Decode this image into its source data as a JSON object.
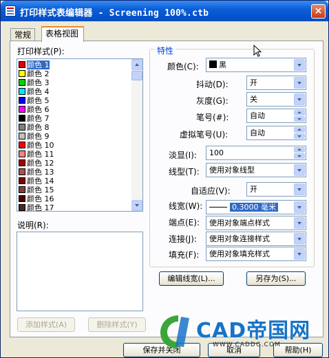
{
  "window": {
    "title": "打印样式表编辑器 - Screening 100%.ctb",
    "close": "×"
  },
  "tabs": [
    "常规",
    "表格视图"
  ],
  "left": {
    "styles_label": "打印样式(P):",
    "items": [
      {
        "label": "颜色 1",
        "color": "#e00000"
      },
      {
        "label": "颜色 2",
        "color": "#ffff00"
      },
      {
        "label": "颜色 3",
        "color": "#00d000"
      },
      {
        "label": "颜色 4",
        "color": "#00e8ff"
      },
      {
        "label": "颜色 5",
        "color": "#0000ff"
      },
      {
        "label": "颜色 6",
        "color": "#ff00ff"
      },
      {
        "label": "颜色 7",
        "color": "#000000"
      },
      {
        "label": "颜色 8",
        "color": "#808080"
      },
      {
        "label": "颜色 9",
        "color": "#c0c0c0"
      },
      {
        "label": "颜色 10",
        "color": "#ff0000"
      },
      {
        "label": "颜色 11",
        "color": "#ff7f7f"
      },
      {
        "label": "颜色 12",
        "color": "#a50000"
      },
      {
        "label": "颜色 13",
        "color": "#a55252"
      },
      {
        "label": "颜色 14",
        "color": "#7f0000"
      },
      {
        "label": "颜色 15",
        "color": "#7f3f3f"
      },
      {
        "label": "颜色 16",
        "color": "#4c0000"
      },
      {
        "label": "颜色 17",
        "color": "#4c2626"
      }
    ],
    "desc_label": "说明(R):",
    "add_button": "添加样式(A)",
    "delete_button": "删除样式(Y)"
  },
  "props": {
    "group_title": "特性",
    "color_label": "颜色(C):",
    "color_value": "黑",
    "color_swatch": "#000000",
    "dither_label": "抖动(D):",
    "dither_value": "开",
    "gray_label": "灰度(G):",
    "gray_value": "关",
    "pen_label": "笔号(#):",
    "pen_value": "自动",
    "vpen_label": "虚拟笔号(U):",
    "vpen_value": "自动",
    "screen_label": "淡显(I):",
    "screen_value": "100",
    "linetype_label": "线型(T):",
    "linetype_value": "使用对象线型",
    "adaptive_label": "自适应(V):",
    "adaptive_value": "开",
    "lineweight_label": "线宽(W):",
    "lineweight_value": "0.3000 毫米",
    "endstyle_label": "端点(E):",
    "endstyle_value": "使用对象端点样式",
    "joinstyle_label": "连接(J):",
    "joinstyle_value": "使用对象连接样式",
    "fillstyle_label": "填充(F):",
    "fillstyle_value": "使用对象填充样式",
    "edit_lw_button": "编辑线宽(L)...",
    "saveas_button": "另存为(S)..."
  },
  "footer": {
    "save_close": "保存并关闭",
    "cancel": "取消",
    "help": "帮助(H)"
  },
  "watermark": {
    "brand": "CAD帝国网",
    "url": "WWW.CADDG.COM"
  }
}
